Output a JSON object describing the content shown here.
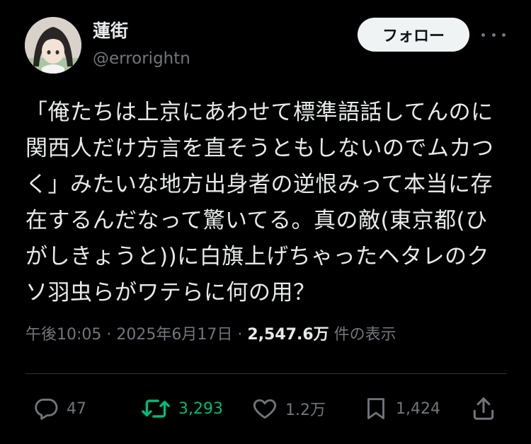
{
  "author": {
    "display_name": "蓮街",
    "handle": "@errorightn"
  },
  "follow_button": {
    "label": "フォロー"
  },
  "more_menu": {
    "icon": "more-icon"
  },
  "tweet": {
    "lines": [
      "「俺たちは上京にあわせて標準語話してんのに",
      "関西人だけ方言を直そうともしないのでムカつ",
      "く」みたいな地方出身者の逆恨みって本当に存",
      "在するんだなって驚いてる。真の敵(東京都(ひ",
      "がしきょうと))に白旗上げちゃったヘタレのク",
      "ソ羽虫らがワテらに何の用？"
    ]
  },
  "meta": {
    "time": "午後10:05",
    "separator": "·",
    "date": "2025年6月17日",
    "views": "2,547.6万",
    "views_label": "件の表示"
  },
  "actions": {
    "replies": "47",
    "retweets": "3,293",
    "likes": "1.2万",
    "bookmarks": "1,424"
  },
  "colors": {
    "background": "#000000",
    "text": "#e7e9ea",
    "secondary": "#71767b",
    "retweet_green": "#00ba7c",
    "divider": "#2f3336"
  }
}
